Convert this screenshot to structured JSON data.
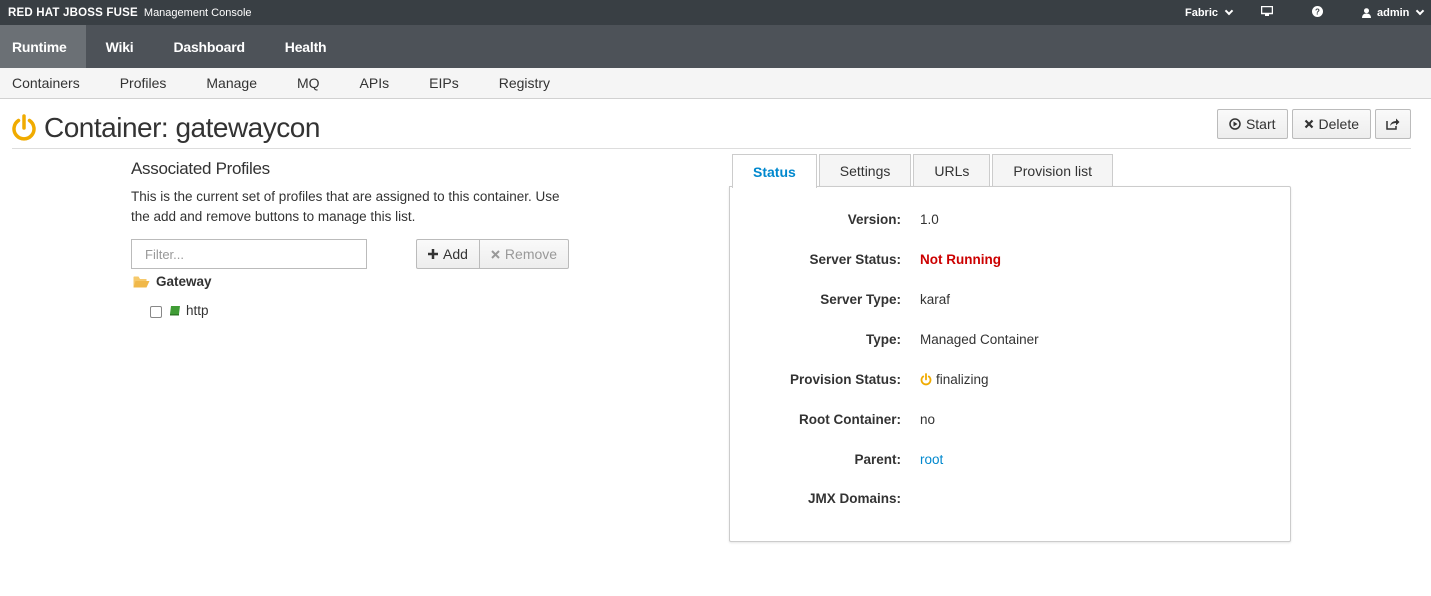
{
  "brand": {
    "name": "RED HAT JBOSS FUSE",
    "subtitle": "Management Console"
  },
  "topright": {
    "fabric": "Fabric",
    "user": "admin",
    "monitor_icon": "monitor-icon",
    "help_icon": "help-icon"
  },
  "mainnav": [
    "Runtime",
    "Wiki",
    "Dashboard",
    "Health"
  ],
  "subnav": [
    "Containers",
    "Profiles",
    "Manage",
    "MQ",
    "APIs",
    "EIPs",
    "Registry"
  ],
  "page": {
    "title": "Container: gatewaycon"
  },
  "actions": {
    "start": "Start",
    "delete": "Delete"
  },
  "profiles": {
    "title": "Associated Profiles",
    "description": "This is the current set of profiles that are assigned to this container. Use the add and remove buttons to manage this list.",
    "filter_placeholder": "Filter...",
    "add": "Add",
    "remove": "Remove",
    "folder": "Gateway",
    "item": "http"
  },
  "tabs": [
    "Status",
    "Settings",
    "URLs",
    "Provision list"
  ],
  "status": [
    {
      "label": "Version:",
      "value": "1.0"
    },
    {
      "label": "Server Status:",
      "value": "Not Running"
    },
    {
      "label": "Server Type:",
      "value": "karaf"
    },
    {
      "label": "Type:",
      "value": "Managed Container"
    },
    {
      "label": "Provision Status:",
      "value": "finalizing"
    },
    {
      "label": "Root Container:",
      "value": "no"
    },
    {
      "label": "Parent:",
      "value": "root"
    },
    {
      "label": "JMX Domains:",
      "value": ""
    }
  ],
  "colors": {
    "accent": "#0088ce",
    "warning": "#f0ab00",
    "danger": "#cc0000",
    "brandbar": "#393f44",
    "nav": "#4d5258"
  }
}
